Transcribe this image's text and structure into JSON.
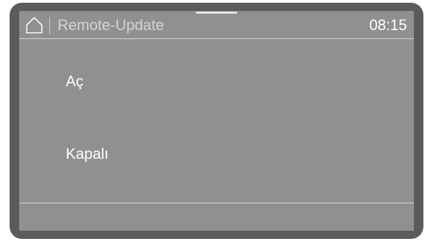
{
  "header": {
    "home_icon": "home-icon",
    "title": "Remote-Update",
    "time": "08:15"
  },
  "options": [
    {
      "label": "Aç"
    },
    {
      "label": "Kapalı"
    }
  ],
  "colors": {
    "screen_background": "#909093",
    "bezel": "#5b5b5d",
    "text": "#ffffff",
    "title_text": "#d4d4d6"
  }
}
